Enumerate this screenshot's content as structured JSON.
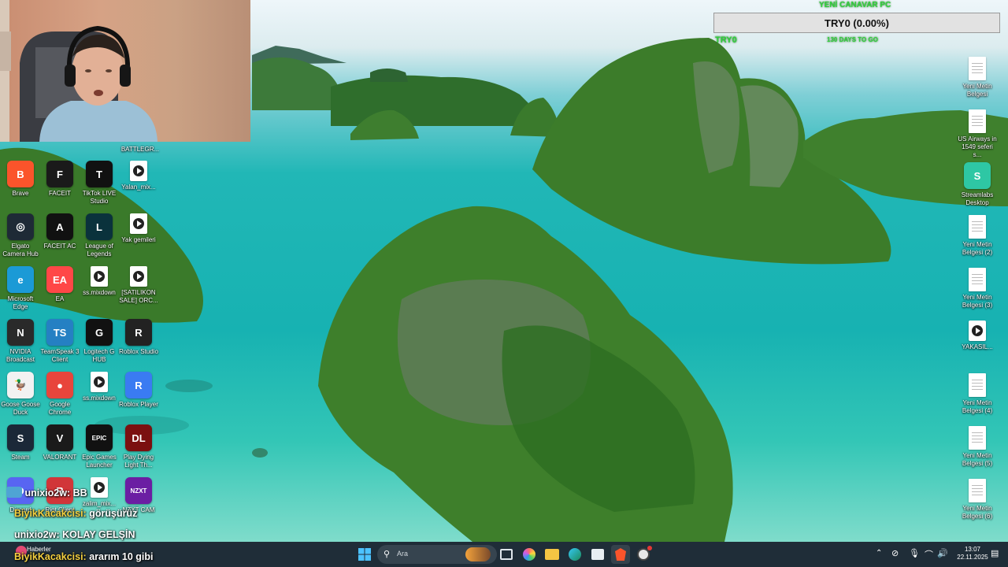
{
  "colors": {
    "goal_green": "#2fd13a",
    "chat_gold": "#f4d040",
    "taskbar_bg": "#1f2d38"
  },
  "goal": {
    "title": "YENİ CANAVAR PC",
    "progress_text": "TRY0 (0.00%)",
    "progress_fraction": 0,
    "current": "TRY0",
    "target_partial": "",
    "days": "130 DAYS TO GO"
  },
  "desktop": {
    "partial_top_label": "BATTLEGR...",
    "left_icons": [
      {
        "name": "brave-icon",
        "label": "Brave"
      },
      {
        "name": "faceit-icon",
        "label": "FACEIT"
      },
      {
        "name": "tiktok-live-studio-icon",
        "label": "TikTok LIVE Studio"
      },
      {
        "name": "video-file-icon",
        "label": "Yalan_mix..."
      },
      {
        "name": "elgato-camera-hub-icon",
        "label": "Elgato Camera Hub"
      },
      {
        "name": "faceit-ac-icon",
        "label": "FACEIT AC"
      },
      {
        "name": "league-of-legends-icon",
        "label": "League of Legends"
      },
      {
        "name": "video-file-icon",
        "label": "Yak gemileri"
      },
      {
        "name": "microsoft-edge-icon",
        "label": "Microsoft Edge"
      },
      {
        "name": "ea-icon",
        "label": "EA"
      },
      {
        "name": "audio-file-icon",
        "label": "ss.mixdown"
      },
      {
        "name": "video-file-icon",
        "label": "[SATILIKON SALE] ORC..."
      },
      {
        "name": "nvidia-broadcast-icon",
        "label": "NVIDIA Broadcast"
      },
      {
        "name": "teamspeak-icon",
        "label": "TeamSpeak 3 Client"
      },
      {
        "name": "logitech-g-hub-icon",
        "label": "Logitech G HUB"
      },
      {
        "name": "roblox-studio-icon",
        "label": "Roblox Studio"
      },
      {
        "name": "goose-goose-duck-icon",
        "label": "Goose Goose Duck"
      },
      {
        "name": "google-chrome-icon",
        "label": "Google Chrome"
      },
      {
        "name": "video-file-icon",
        "label": "ss.mixdown"
      },
      {
        "name": "roblox-player-icon",
        "label": "Roblox Player"
      },
      {
        "name": "steam-icon",
        "label": "Steam"
      },
      {
        "name": "valorant-icon",
        "label": "VALORANT"
      },
      {
        "name": "epic-games-icon",
        "label": "Epic Games Launcher"
      },
      {
        "name": "dying-light-icon",
        "label": "Play Dying Light Th..."
      },
      {
        "name": "discord-icon",
        "label": "Discord"
      },
      {
        "name": "riot-client-icon",
        "label": "Riot Client"
      },
      {
        "name": "video-file-icon",
        "label": "zalim_mix..."
      },
      {
        "name": "nzxt-cam-icon",
        "label": "NZXT CAM"
      }
    ],
    "right_icons": [
      {
        "name": "text-file-icon",
        "label": "Yeni Metin Belgesi"
      },
      {
        "name": "text-file-icon",
        "label": "US Airways in 1549 seferi s..."
      },
      {
        "name": "streamlabs-desktop-icon",
        "label": "Streamlabs Desktop"
      },
      {
        "name": "text-file-icon",
        "label": "Yeni Metin Belgesi (2)"
      },
      {
        "name": "text-file-icon",
        "label": "Yeni Metin Belgesi (3)"
      },
      {
        "name": "video-file-icon",
        "label": "YAKASIL..."
      },
      {
        "name": "text-file-icon",
        "label": "Yeni Metin Belgesi (4)"
      },
      {
        "name": "text-file-icon",
        "label": "Yeni Metin Belgesi (5)"
      },
      {
        "name": "text-file-icon",
        "label": "Yeni Metin Belgesi (6)"
      }
    ]
  },
  "chat": [
    {
      "user": "unixio2w:",
      "msg": "BB"
    },
    {
      "user": "BiyikKacakcisi:",
      "msg": "görüşürüz"
    },
    {
      "user": "unixio2w:",
      "msg": "KOLAY GELŞİN"
    },
    {
      "user": "BiyikKacakcisi:",
      "msg": "ararım 10 gibi"
    }
  ],
  "taskbar": {
    "news_label": "Haberler",
    "search_placeholder": "Ara",
    "time": "13:07",
    "date": "22.11.2025"
  }
}
